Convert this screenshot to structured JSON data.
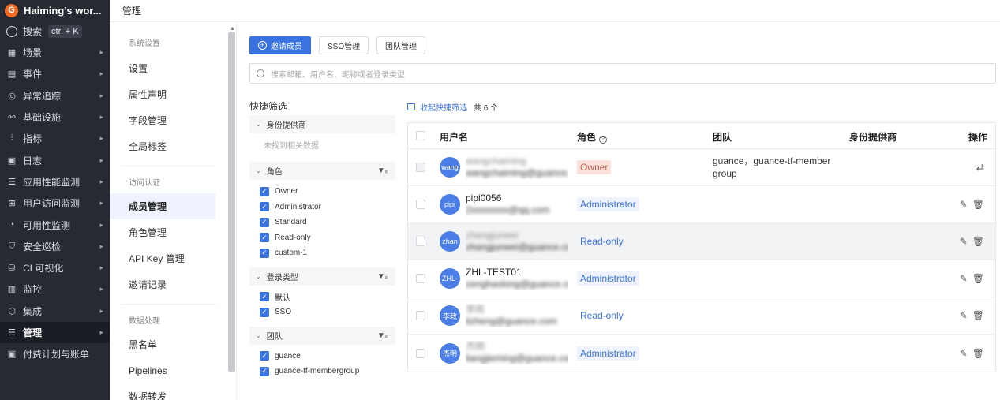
{
  "app": {
    "name": "Haiming’s wor...",
    "logo_letter": "G"
  },
  "search": {
    "label": "搜索",
    "shortcut": "ctrl + K"
  },
  "nav": [
    {
      "label": "场景",
      "icon": "layout-icon"
    },
    {
      "label": "事件",
      "icon": "calendar-icon"
    },
    {
      "label": "异常追踪",
      "icon": "bug-icon"
    },
    {
      "label": "基础设施",
      "icon": "nodes-icon"
    },
    {
      "label": "指标",
      "icon": "chart-icon"
    },
    {
      "label": "日志",
      "icon": "log-icon"
    },
    {
      "label": "应用性能监测",
      "icon": "apm-icon"
    },
    {
      "label": "用户访问监测",
      "icon": "rum-icon"
    },
    {
      "label": "可用性监测",
      "icon": "dial-icon"
    },
    {
      "label": "安全巡检",
      "icon": "shield-icon"
    },
    {
      "label": "CI 可视化",
      "icon": "ci-icon"
    },
    {
      "label": "监控",
      "icon": "monitor-icon"
    },
    {
      "label": "集成",
      "icon": "integration-icon"
    },
    {
      "label": "管理",
      "icon": "manage-icon",
      "active": true
    },
    {
      "label": "付费计划与账单",
      "icon": "billing-icon"
    }
  ],
  "header": {
    "title": "管理"
  },
  "subnav": {
    "group1": "系统设置",
    "items1": [
      "设置",
      "属性声明",
      "字段管理",
      "全局标签"
    ],
    "group2": "访问认证",
    "items2": [
      "成员管理",
      "角色管理",
      "API Key 管理",
      "邀请记录"
    ],
    "group3": "数据处理",
    "items3": [
      "黑名单",
      "Pipelines",
      "数据转发"
    ]
  },
  "toolbar": {
    "invite": "邀请成员",
    "sso": "SSO管理",
    "team": "团队管理"
  },
  "search_input": {
    "placeholder": "搜索邮箱、用户名、昵称或者登录类型"
  },
  "filters": {
    "title": "快捷筛选",
    "provider": {
      "label": "身份提供商",
      "empty": "未找到相关数据"
    },
    "role": {
      "label": "角色",
      "options": [
        "Owner",
        "Administrator",
        "Standard",
        "Read-only",
        "custom-1"
      ]
    },
    "login": {
      "label": "登录类型",
      "options": [
        "默认",
        "SSO"
      ]
    },
    "team": {
      "label": "团队",
      "options": [
        "guance",
        "guance-tf-membergroup"
      ]
    }
  },
  "table_bar": {
    "collapse": "收起快捷筛选",
    "total": "共 6 个"
  },
  "table": {
    "headers": {
      "user": "用户名",
      "role": "角色",
      "team": "团队",
      "provider": "身份提供商",
      "ops": "操作"
    },
    "rows": [
      {
        "avatar": "wang",
        "name": "wangchaiming",
        "email": "wangchaiming@guance.com",
        "role": "Owner",
        "team": "guance，guance-tf-member group"
      },
      {
        "avatar": "pipi",
        "name": "pipi0056",
        "email": "2xxxxxxxx@qq.com",
        "role": "Administrator",
        "team": ""
      },
      {
        "avatar": "zhan",
        "name": "zhangjunwei",
        "email": "zhangjunwei@guance.com",
        "role": "Read-only",
        "team": ""
      },
      {
        "avatar": "ZHL-",
        "name": "ZHL-TEST01",
        "email": "zenghaolong@guance.com",
        "role": "Administrator",
        "team": ""
      },
      {
        "avatar": "李政",
        "name": "李政",
        "email": "lizheng@guance.com",
        "role": "Read-only",
        "team": ""
      },
      {
        "avatar": "杰明",
        "name": "杰明",
        "email": "liangjieming@guance.com",
        "role": "Administrator",
        "team": ""
      }
    ]
  }
}
